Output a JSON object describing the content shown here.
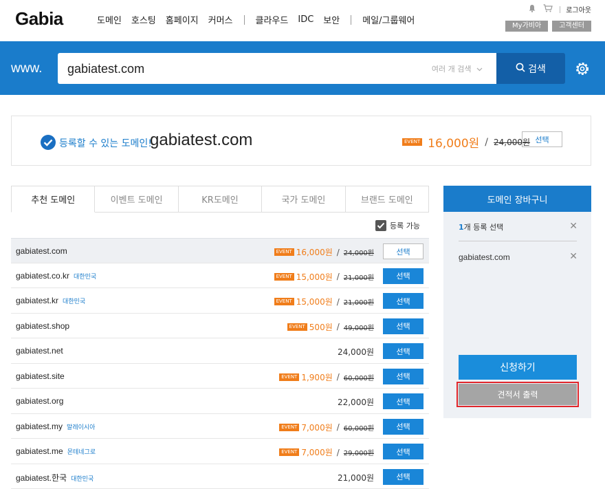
{
  "header": {
    "logo": "Gabia",
    "nav": [
      "도메인",
      "호스팅",
      "홈페이지",
      "커머스",
      "클라우드",
      "IDC",
      "보안",
      "메일/그룹웨어"
    ],
    "logout": "로그아웃",
    "my_gabia": "My가비아",
    "customer_center": "고객센터"
  },
  "search": {
    "prefix": "www.",
    "value": "gabiatest.com",
    "multi_search": "여러 개 검색",
    "button": "검색"
  },
  "result": {
    "available_text": "등록할 수 있는 도메인!",
    "domain": "gabiatest.com",
    "event": "EVENT",
    "price": "16,000원",
    "slash": "/",
    "original_price": "24,000원",
    "select": "선택"
  },
  "tabs": [
    "추천 도메인",
    "이벤트 도메인",
    "KR도메인",
    "국가 도메인",
    "브랜드 도메인"
  ],
  "filter_label": "등록 가능",
  "rows": [
    {
      "domain": "gabiatest.com",
      "country": "",
      "event": "EVENT",
      "price": "16,000원",
      "original": "24,000원",
      "select": "선택"
    },
    {
      "domain": "gabiatest.co.kr",
      "country": "대한민국",
      "event": "EVENT",
      "price": "15,000원",
      "original": "21,000원",
      "select": "선택"
    },
    {
      "domain": "gabiatest.kr",
      "country": "대한민국",
      "event": "EVENT",
      "price": "15,000원",
      "original": "21,000원",
      "select": "선택"
    },
    {
      "domain": "gabiatest.shop",
      "country": "",
      "event": "EVENT",
      "price": "500원",
      "original": "49,000원",
      "select": "선택"
    },
    {
      "domain": "gabiatest.net",
      "country": "",
      "event": "",
      "price": "24,000원",
      "original": "",
      "select": "선택"
    },
    {
      "domain": "gabiatest.site",
      "country": "",
      "event": "EVENT",
      "price": "1,900원",
      "original": "60,000원",
      "select": "선택"
    },
    {
      "domain": "gabiatest.org",
      "country": "",
      "event": "",
      "price": "22,000원",
      "original": "",
      "select": "선택"
    },
    {
      "domain": "gabiatest.my",
      "country": "말레이시아",
      "event": "EVENT",
      "price": "7,000원",
      "original": "60,000원",
      "select": "선택"
    },
    {
      "domain": "gabiatest.me",
      "country": "몬테네그로",
      "event": "EVENT",
      "price": "7,000원",
      "original": "29,000원",
      "select": "선택"
    },
    {
      "domain": "gabiatest.한국",
      "country": "대한민국",
      "event": "",
      "price": "21,000원",
      "original": "",
      "select": "선택"
    }
  ],
  "cart": {
    "title": "도메인 장바구니",
    "count": "1",
    "count_suffix": "개 등록 선택",
    "item": "gabiatest.com",
    "apply": "신청하기",
    "estimate": "견적서 출력"
  },
  "colors": {
    "brand": "#1a7ccb",
    "event": "#f07d1a",
    "highlight": "#e0262b"
  }
}
